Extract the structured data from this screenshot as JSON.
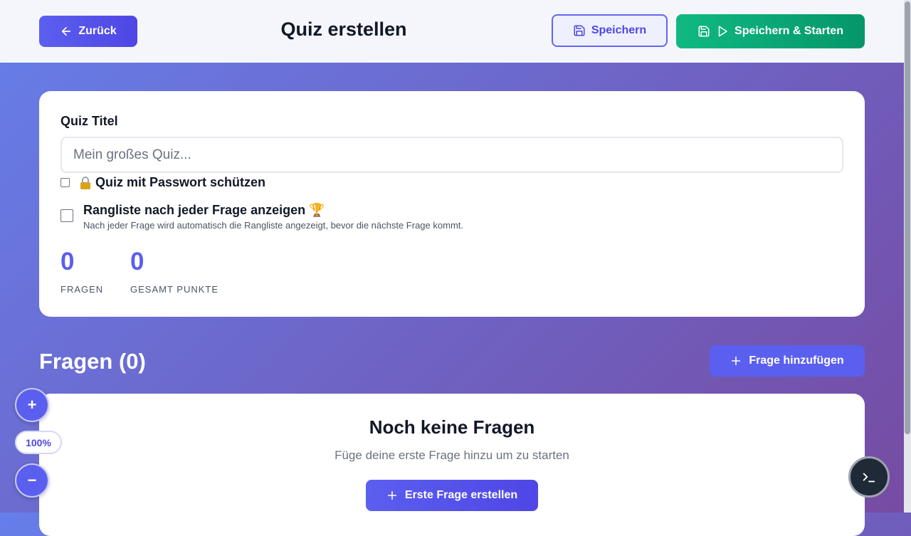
{
  "header": {
    "back_label": "Zurück",
    "title": "Quiz erstellen",
    "save_label": "Speichern",
    "save_start_label": "Speichern & Starten"
  },
  "quiz_settings": {
    "title_label": "Quiz Titel",
    "title_placeholder": "Mein großes Quiz...",
    "title_value": "",
    "password_label": "Quiz mit Passwort schützen",
    "password_checked": false,
    "leaderboard_label": "Rangliste nach jeder Frage anzeigen 🏆",
    "leaderboard_desc": "Nach jeder Frage wird automatisch die Rangliste angezeigt, bevor die nächste Frage kommt.",
    "leaderboard_checked": false
  },
  "stats": {
    "questions_value": "0",
    "questions_label": "FRAGEN",
    "points_value": "0",
    "points_label": "GESAMT PUNKTE"
  },
  "questions_section": {
    "title": "Fragen (0)",
    "add_label": "Frage hinzufügen"
  },
  "empty_state": {
    "title": "Noch keine Fragen",
    "subtitle": "Füge deine erste Frage hinzu um zu starten",
    "button_label": "Erste Frage erstellen"
  },
  "zoom": {
    "zoom_in_label": "+",
    "zoom_out_label": "−",
    "level": "100%"
  },
  "colors": {
    "primary": "#5b5fef",
    "success": "#10b981",
    "gradient_start": "#667eea",
    "gradient_end": "#764ba2"
  },
  "icons": [
    "arrow-left-icon",
    "save-icon",
    "play-icon",
    "lock-icon",
    "plus-icon",
    "terminal-icon"
  ]
}
